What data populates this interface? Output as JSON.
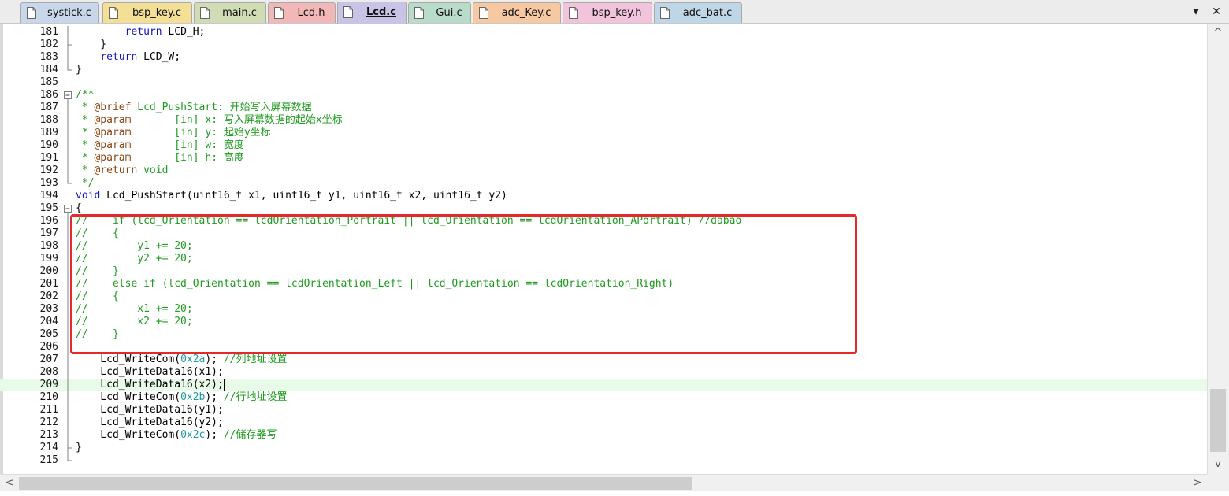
{
  "tabs": [
    {
      "label": "systick.c",
      "color": "#c9d7ea",
      "active": false
    },
    {
      "label": "bsp_key.c",
      "color": "#f3df95",
      "active": false
    },
    {
      "label": "main.c",
      "color": "#cfdcb4",
      "active": false
    },
    {
      "label": "Lcd.h",
      "color": "#f2b8b8",
      "active": false
    },
    {
      "label": "Lcd.c",
      "color": "#c9c3e6",
      "active": true
    },
    {
      "label": "Gui.c",
      "color": "#b9dbc9",
      "active": false
    },
    {
      "label": "adc_Key.c",
      "color": "#f7c9a2",
      "active": false
    },
    {
      "label": "bsp_key.h",
      "color": "#f1c4dc",
      "active": false
    },
    {
      "label": "adc_bat.c",
      "color": "#bfd6e6",
      "active": false
    }
  ],
  "window_controls": {
    "dropdown": "▾",
    "close": "✕"
  },
  "editor": {
    "current_line": 209,
    "lines": [
      {
        "n": "181",
        "tokens": [
          [
            "",
            "        "
          ],
          [
            "kw",
            "return"
          ],
          [
            "",
            " LCD_H;"
          ]
        ]
      },
      {
        "n": "182",
        "tokens": [
          [
            "",
            "    }"
          ]
        ]
      },
      {
        "n": "183",
        "tokens": [
          [
            "",
            "    "
          ],
          [
            "kw",
            "return"
          ],
          [
            "",
            " LCD_W;"
          ]
        ]
      },
      {
        "n": "184",
        "tokens": [
          [
            "",
            "}"
          ]
        ]
      },
      {
        "n": "185",
        "tokens": []
      },
      {
        "n": "186",
        "tokens": [
          [
            "cm",
            "/**"
          ]
        ]
      },
      {
        "n": "187",
        "tokens": [
          [
            "cm",
            " * "
          ],
          [
            "doc",
            "@brief"
          ],
          [
            "cm",
            " Lcd_PushStart: 开始写入屏幕数据"
          ]
        ]
      },
      {
        "n": "188",
        "tokens": [
          [
            "cm",
            " * "
          ],
          [
            "doc",
            "@param"
          ],
          [
            "cm",
            "       [in] x: 写入屏幕数据的起始x坐标"
          ]
        ]
      },
      {
        "n": "189",
        "tokens": [
          [
            "cm",
            " * "
          ],
          [
            "doc",
            "@param"
          ],
          [
            "cm",
            "       [in] y: 起始y坐标"
          ]
        ]
      },
      {
        "n": "190",
        "tokens": [
          [
            "cm",
            " * "
          ],
          [
            "doc",
            "@param"
          ],
          [
            "cm",
            "       [in] w: 宽度"
          ]
        ]
      },
      {
        "n": "191",
        "tokens": [
          [
            "cm",
            " * "
          ],
          [
            "doc",
            "@param"
          ],
          [
            "cm",
            "       [in] h: 高度"
          ]
        ]
      },
      {
        "n": "192",
        "tokens": [
          [
            "cm",
            " * "
          ],
          [
            "doc",
            "@return"
          ],
          [
            "cm",
            " void"
          ]
        ]
      },
      {
        "n": "193",
        "tokens": [
          [
            "cm",
            " */"
          ]
        ]
      },
      {
        "n": "194",
        "tokens": [
          [
            "kw",
            "void"
          ],
          [
            "",
            " Lcd_PushStart(uint16_t x1, uint16_t y1, uint16_t x2, uint16_t y2)"
          ]
        ]
      },
      {
        "n": "195",
        "tokens": [
          [
            "",
            "{"
          ]
        ]
      },
      {
        "n": "196",
        "tokens": [
          [
            "cm",
            "//    if (lcd_Orientation == lcdOrientation_Portrait || lcd_Orientation == lcdOrientation_APortrait) //dabao"
          ]
        ]
      },
      {
        "n": "197",
        "tokens": [
          [
            "cm",
            "//    {"
          ]
        ]
      },
      {
        "n": "198",
        "tokens": [
          [
            "cm",
            "//        y1 += 20;"
          ]
        ]
      },
      {
        "n": "199",
        "tokens": [
          [
            "cm",
            "//        y2 += 20;"
          ]
        ]
      },
      {
        "n": "200",
        "tokens": [
          [
            "cm",
            "//    }"
          ]
        ]
      },
      {
        "n": "201",
        "tokens": [
          [
            "cm",
            "//    else if (lcd_Orientation == lcdOrientation_Left || lcd_Orientation == lcdOrientation_Right)"
          ]
        ]
      },
      {
        "n": "202",
        "tokens": [
          [
            "cm",
            "//    {"
          ]
        ]
      },
      {
        "n": "203",
        "tokens": [
          [
            "cm",
            "//        x1 += 20;"
          ]
        ]
      },
      {
        "n": "204",
        "tokens": [
          [
            "cm",
            "//        x2 += 20;"
          ]
        ]
      },
      {
        "n": "205",
        "tokens": [
          [
            "cm",
            "//    }"
          ]
        ]
      },
      {
        "n": "206",
        "tokens": []
      },
      {
        "n": "207",
        "tokens": [
          [
            "",
            "    Lcd_WriteCom("
          ],
          [
            "hex",
            "0x2a"
          ],
          [
            "",
            "); "
          ],
          [
            "cm",
            "//列地址设置"
          ]
        ]
      },
      {
        "n": "208",
        "tokens": [
          [
            "",
            "    Lcd_WriteData16(x1);"
          ]
        ]
      },
      {
        "n": "209",
        "tokens": [
          [
            "",
            "    Lcd_WriteData16(x2);"
          ]
        ]
      },
      {
        "n": "210",
        "tokens": [
          [
            "",
            "    Lcd_WriteCom("
          ],
          [
            "hex",
            "0x2b"
          ],
          [
            "",
            "); "
          ],
          [
            "cm",
            "//行地址设置"
          ]
        ]
      },
      {
        "n": "211",
        "tokens": [
          [
            "",
            "    Lcd_WriteData16(y1);"
          ]
        ]
      },
      {
        "n": "212",
        "tokens": [
          [
            "",
            "    Lcd_WriteData16(y2);"
          ]
        ]
      },
      {
        "n": "213",
        "tokens": [
          [
            "",
            "    Lcd_WriteCom("
          ],
          [
            "hex",
            "0x2c"
          ],
          [
            "",
            "); "
          ],
          [
            "cm",
            "//储存器写"
          ]
        ]
      },
      {
        "n": "214",
        "tokens": [
          [
            "",
            "}"
          ]
        ]
      },
      {
        "n": "215",
        "tokens": []
      }
    ]
  },
  "scrollbar": {
    "up": "^",
    "down": "v",
    "left": "<",
    "right": ">"
  }
}
